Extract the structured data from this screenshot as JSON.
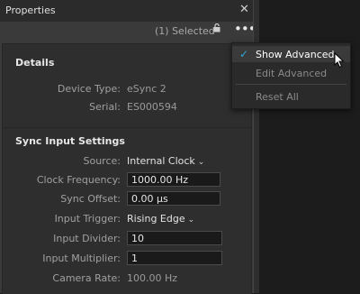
{
  "window": {
    "title": "Properties",
    "close_glyph": "✕"
  },
  "toolbar": {
    "selected_text": "(1) Selected",
    "more_glyph": "•••"
  },
  "details": {
    "title": "Details",
    "device_type_label": "Device Type:",
    "device_type_value": "eSync 2",
    "serial_label": "Serial:",
    "serial_value": "ES000594"
  },
  "sync": {
    "title": "Sync Input Settings",
    "source_label": "Source:",
    "source_value": "Internal Clock",
    "clock_frequency_label": "Clock Frequency:",
    "clock_frequency_value": "1000.00 Hz",
    "sync_offset_label": "Sync Offset:",
    "sync_offset_value": "0.00 µs",
    "input_trigger_label": "Input Trigger:",
    "input_trigger_value": "Rising Edge",
    "input_divider_label": "Input Divider:",
    "input_divider_value": "10",
    "input_multiplier_label": "Input Multiplier:",
    "input_multiplier_value": "1",
    "camera_rate_label": "Camera Rate:",
    "camera_rate_value": "100.00 Hz"
  },
  "menu": {
    "show_advanced": "Show Advanced",
    "edit_advanced": "Edit Advanced",
    "reset_all": "Reset All",
    "checked_item": "show_advanced"
  },
  "icons": {
    "lock": "lock-icon",
    "check": "checkmark-icon",
    "chevron": "chevron-down-icon",
    "cursor": "mouse-pointer-icon"
  },
  "colors": {
    "accent_check": "#2fa8d8",
    "panel_bg": "#3a3a3a",
    "section_bg": "#2e2e2e"
  }
}
